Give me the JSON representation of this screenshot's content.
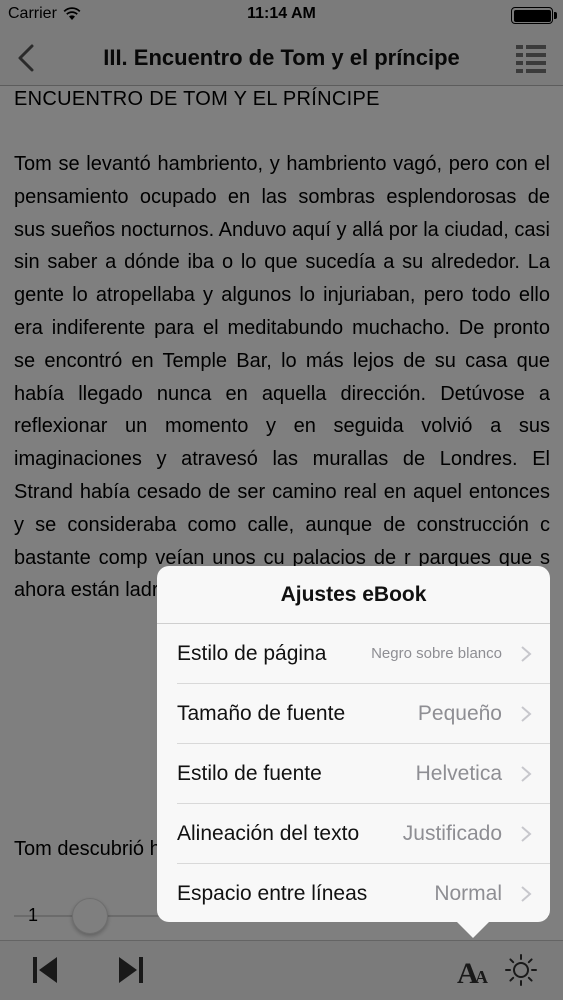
{
  "status_bar": {
    "carrier": "Carrier",
    "time": "11:14 AM"
  },
  "nav": {
    "title": "III. Encuentro de Tom y el príncipe"
  },
  "reader": {
    "chapter_heading": "ENCUENTRO DE TOM Y EL PRÍNCIPE",
    "paragraphs": [
      "Tom se levantó hambriento, y hambriento vagó, pero con el pensamiento ocupado en las sombras esplendorosas de sus sueños nocturnos. Anduvo aquí y allá por la ciudad, casi sin saber a dónde iba o lo que sucedía a su alrededor. La gente lo atropellaba y algunos lo injuriaban, pero todo ello era indiferente para el meditabundo muchacho. De pronto se encontró en Temple Bar, lo más lejos de su casa que había llegado nunca en aquella dirección. Detúvose a reflexionar un momento y en seguida volvió a sus imaginaciones y atravesó las murallas de Londres. El Strand había cesado de ser camino real en aquel entonces y se consideraba como calle, aunque de construcción c bastante comp veían unos cu palacios de r parques que s ahora están ladrillo y piedra",
      "Tom descubrió hermosa cruz"
    ]
  },
  "page_slider": {
    "page_number": "1",
    "progress": 0.0
  },
  "popover": {
    "title": "Ajustes eBook",
    "rows": [
      {
        "label": "Estilo de página",
        "value": "Negro sobre blanco",
        "value_size": "small"
      },
      {
        "label": "Tamaño de fuente",
        "value": "Pequeño",
        "value_size": "normal"
      },
      {
        "label": "Estilo de fuente",
        "value": "Helvetica",
        "value_size": "normal"
      },
      {
        "label": "Alineación del texto",
        "value": "Justificado",
        "value_size": "normal"
      },
      {
        "label": "Espacio entre líneas",
        "value": "Normal",
        "value_size": "normal"
      }
    ]
  },
  "icons": {
    "back": "chevron-left-icon",
    "toc": "list-icon",
    "prev": "skip-back-icon",
    "next": "skip-forward-icon",
    "font": "font-size-icon",
    "brightness": "brightness-icon",
    "wifi": "wifi-icon",
    "battery": "battery-icon"
  },
  "colors": {
    "accent": "#8e8e93",
    "bar_bg": "#f7f7f7",
    "dim_overlay": "rgba(0,0,0,0.5)"
  }
}
